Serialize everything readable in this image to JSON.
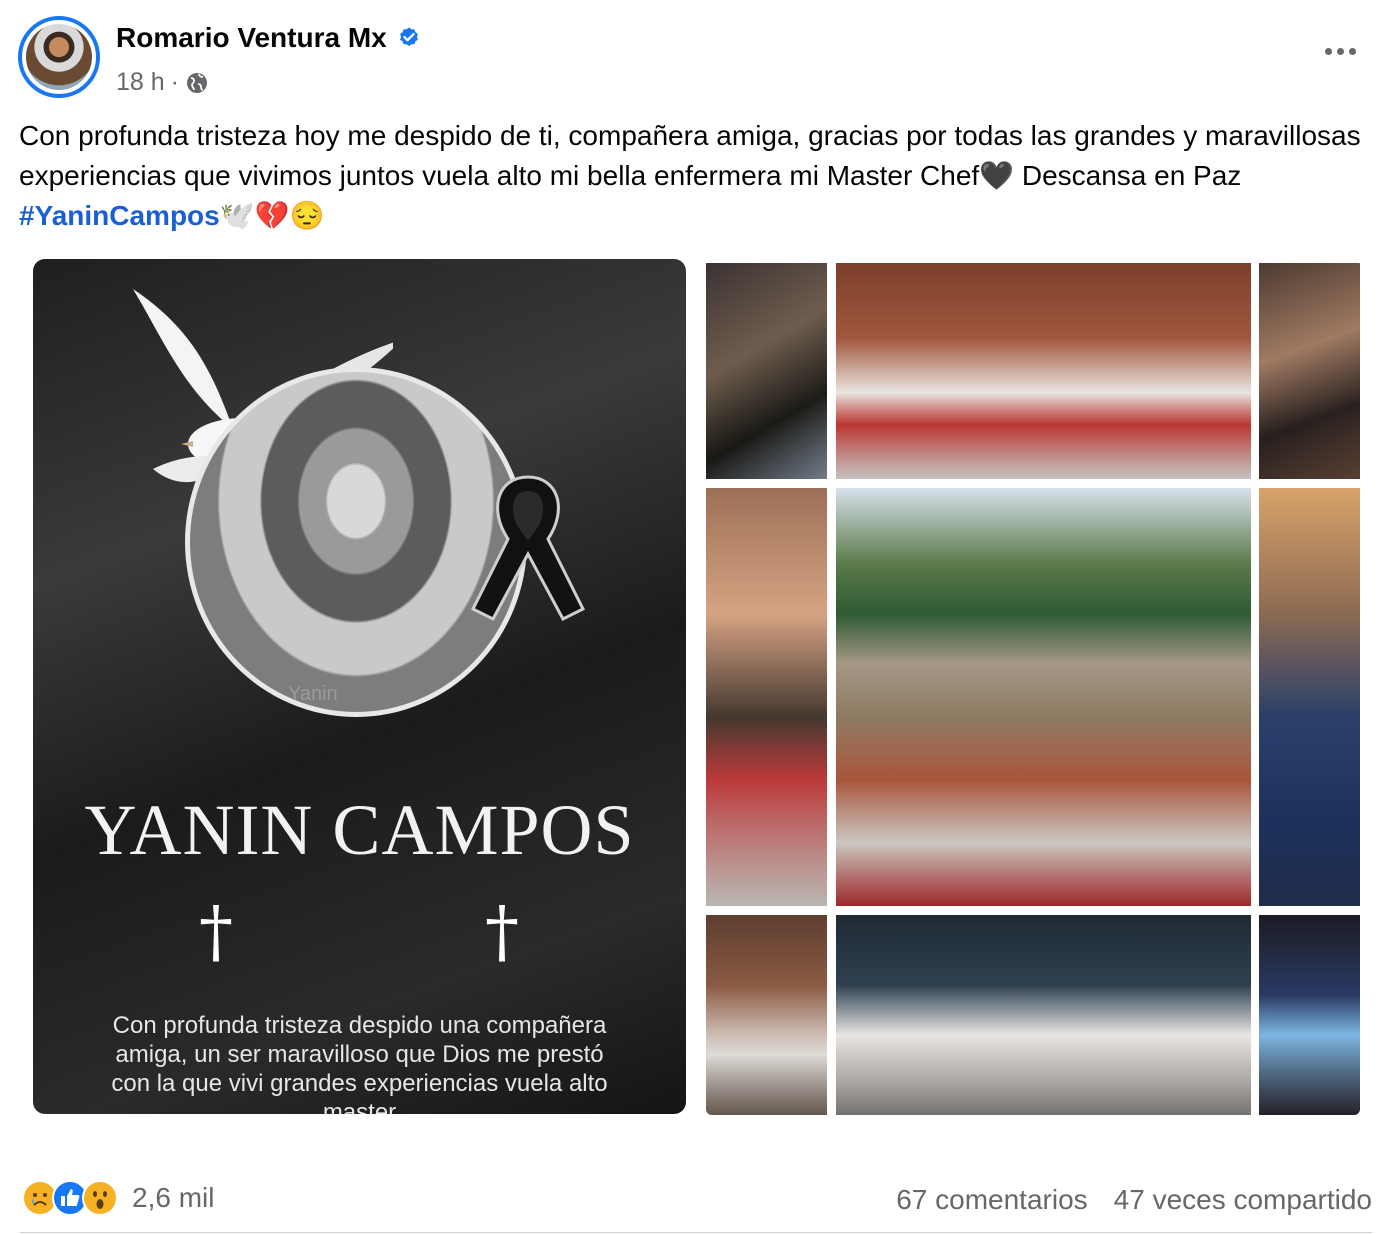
{
  "post": {
    "author_name": "Romario Ventura Mx",
    "timestamp": "18 h",
    "separator": "·",
    "text_main": "Con profunda tristeza hoy me despido de ti, compañera amiga,  gracias por todas las grandes y maravillosas experiencias que vivimos juntos vuela alto mi bella enfermera mi Master Chef🖤 Descansa en Paz ",
    "hashtag": "#YaninCampos",
    "text_emojis": "🕊️💔😔"
  },
  "memorial_image": {
    "portrait_label": "Yanin",
    "title": "YANIN CAMPOS",
    "cross_left": "†",
    "cross_right": "†",
    "caption": "Con profunda tristeza despido una compañera amiga, un ser maravilloso que Dios me prestó con la que vivi grandes experiencias vuela alto master"
  },
  "footer": {
    "reaction_count": "2,6 mil",
    "comments": "67 comentarios",
    "shares": "47 veces compartido"
  },
  "colors": {
    "brand_blue": "#1877f2",
    "hashtag_blue": "#1b5fd1",
    "secondary_text": "#65676b"
  }
}
